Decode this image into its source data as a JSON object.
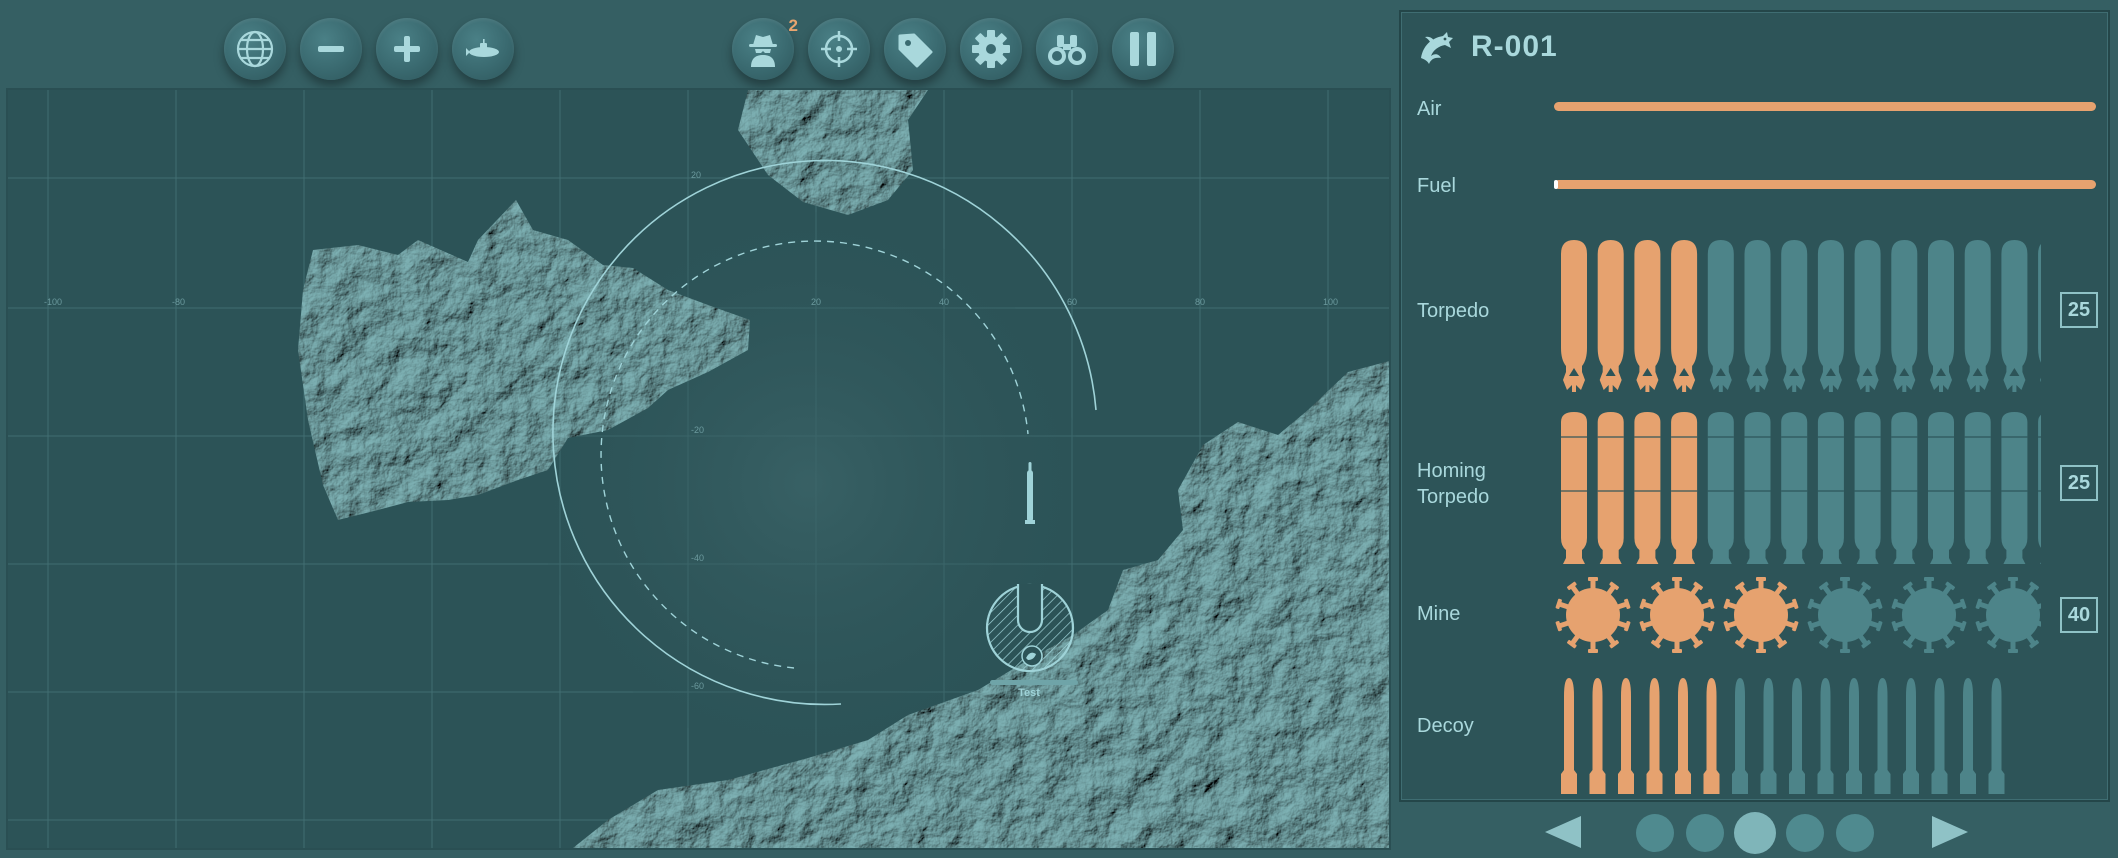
{
  "toolbar": {
    "buttons": [
      {
        "name": "globe-button",
        "icon": "globe-icon"
      },
      {
        "name": "zoom-out-button",
        "icon": "minus-icon"
      },
      {
        "name": "zoom-in-button",
        "icon": "plus-icon"
      },
      {
        "name": "submarine-button",
        "icon": "submarine-icon"
      },
      {
        "name": "spy-button",
        "icon": "spy-icon",
        "badge": "2"
      },
      {
        "name": "target-button",
        "icon": "crosshair-icon"
      },
      {
        "name": "tag-button",
        "icon": "tag-icon"
      },
      {
        "name": "settings-button",
        "icon": "gear-icon"
      },
      {
        "name": "binoculars-button",
        "icon": "binoculars-icon"
      },
      {
        "name": "pause-button",
        "icon": "pause-icon"
      }
    ]
  },
  "map": {
    "player_label": "Test"
  },
  "panel": {
    "title": "R-001",
    "emblem": "dragon-icon",
    "colors": {
      "filled": "#e6a26f",
      "empty": "#4d8489",
      "panel": "#2d5458"
    },
    "air": {
      "label": "Air",
      "level": 1.0
    },
    "fuel": {
      "label": "Fuel",
      "level": 1.0
    },
    "torpedo": {
      "label": "Torpedo",
      "filled": 4,
      "total": 14,
      "count": "25"
    },
    "homing": {
      "label_line1": "Homing",
      "label_line2": "Torpedo",
      "filled": 4,
      "total": 14,
      "count": "25"
    },
    "mine": {
      "label": "Mine",
      "filled": 3,
      "total": 6,
      "count": "40"
    },
    "decoy": {
      "label": "Decoy",
      "filled": 6,
      "total": 16
    }
  },
  "pager": {
    "pages": 5,
    "active": 2
  }
}
